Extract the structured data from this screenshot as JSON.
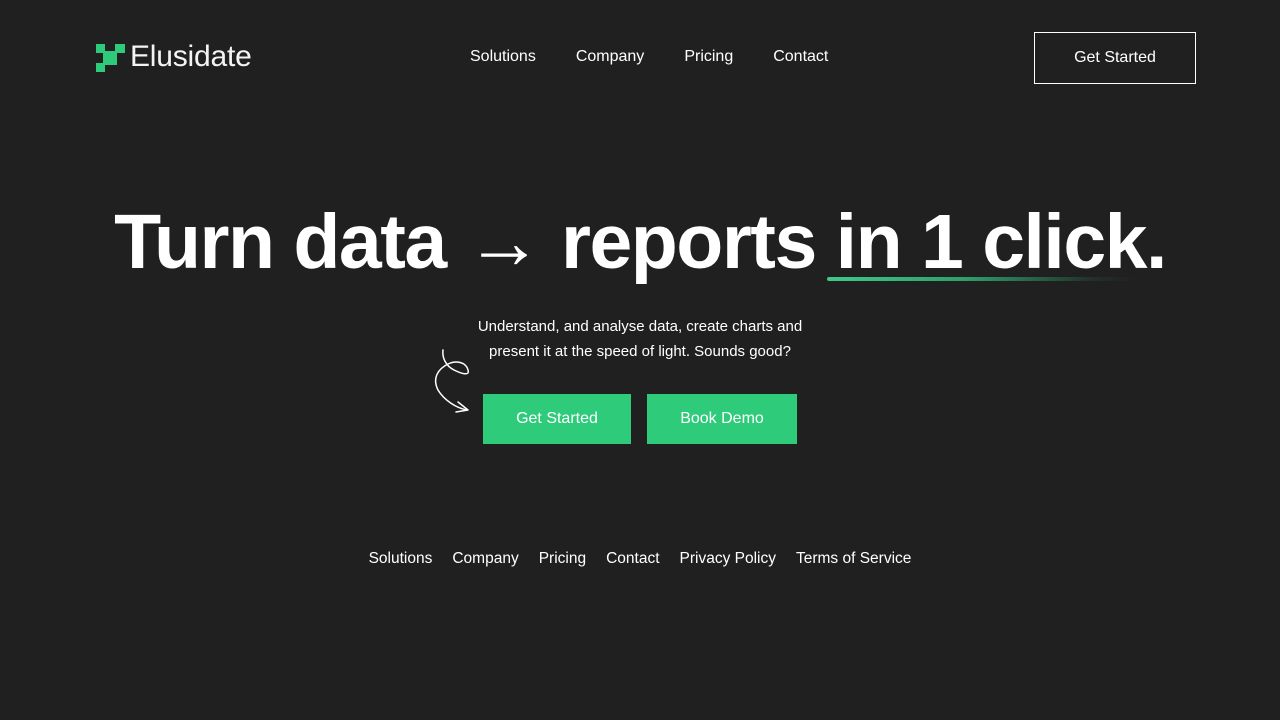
{
  "brand": {
    "name": "Elusidate",
    "logo_icon": "pixel-mark-icon",
    "accent_color": "#2ecc7a",
    "background_color": "#202020"
  },
  "header": {
    "nav": [
      {
        "label": "Solutions"
      },
      {
        "label": "Company"
      },
      {
        "label": "Pricing"
      },
      {
        "label": "Contact"
      }
    ],
    "cta_label": "Get Started"
  },
  "hero": {
    "title_part1": "Turn data → reports ",
    "title_highlight": "in 1 click.",
    "subtitle_line1": "Understand, and analyse data, create charts and",
    "subtitle_line2": "present it at the speed of light. Sounds good?",
    "decoration_icon": "curly-arrow-icon",
    "primary_button": "Get Started",
    "secondary_button": "Book Demo"
  },
  "footer": {
    "links": [
      {
        "label": "Solutions"
      },
      {
        "label": "Company"
      },
      {
        "label": "Pricing"
      },
      {
        "label": "Contact"
      },
      {
        "label": "Privacy Policy"
      },
      {
        "label": "Terms of Service"
      }
    ]
  }
}
